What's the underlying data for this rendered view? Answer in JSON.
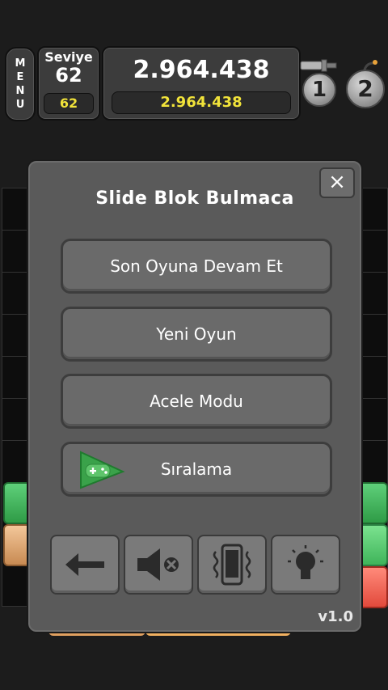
{
  "hud": {
    "menu_label": "M E N U",
    "menu_letters": [
      "M",
      "E",
      "N",
      "U"
    ],
    "level_title": "Seviye",
    "level_value": "62",
    "level_best": "62",
    "score_value": "2.964.438",
    "score_best": "2.964.438",
    "hammer_count": "1",
    "bomb_count": "2"
  },
  "dialog": {
    "title": "Slide Blok Bulmaca",
    "close_label": "×",
    "options": [
      {
        "label": "Son Oyuna Devam Et"
      },
      {
        "label": "Yeni Oyun"
      },
      {
        "label": "Acele Modu"
      },
      {
        "label": "Sıralama"
      }
    ],
    "tools": [
      {
        "icon": "back-arrow-icon"
      },
      {
        "icon": "sound-off-icon"
      },
      {
        "icon": "vibration-icon"
      },
      {
        "icon": "hint-bulb-icon"
      }
    ],
    "version": "v1.0"
  },
  "colors": {
    "accent_yellow": "#f1e33a",
    "dialog_bg": "#5a5a5a",
    "button_bg": "#6a6a6a",
    "block_green": "#43b55a",
    "block_red": "#e8584c",
    "block_orange": "#e0a060"
  }
}
